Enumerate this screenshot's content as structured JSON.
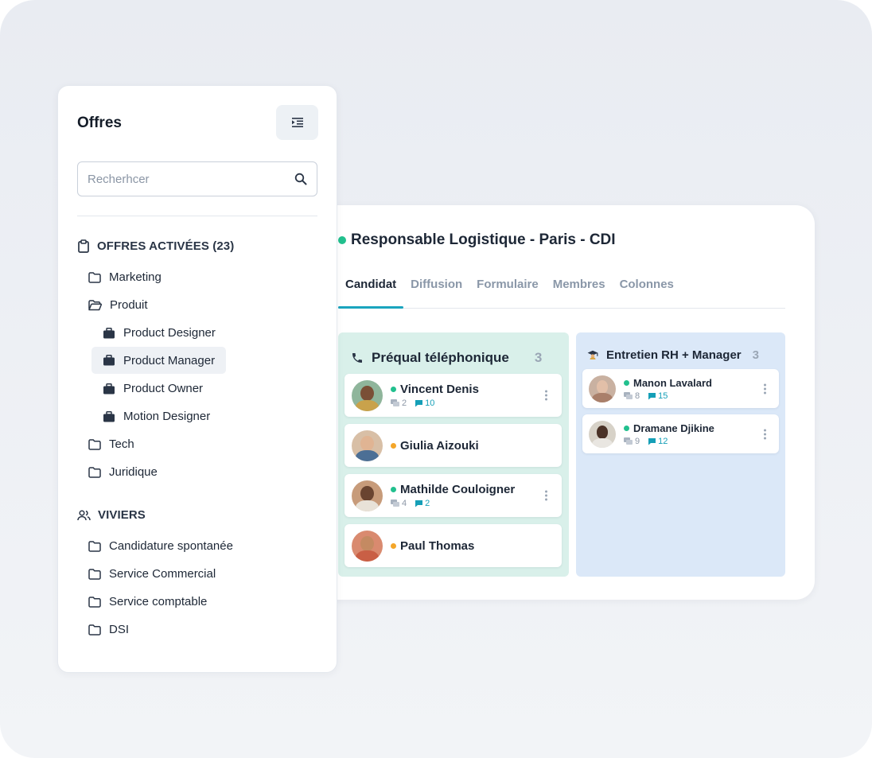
{
  "sidebar": {
    "title": "Offres",
    "search_placeholder": "Recherhcer",
    "active_section": "OFFRES ACTIVÉES (23)",
    "active_folders": {
      "marketing": "Marketing",
      "produit": "Produit",
      "produit_items": [
        "Product Designer",
        "Product Manager",
        "Product Owner",
        "Motion Designer"
      ],
      "tech": "Tech",
      "juridique": "Juridique"
    },
    "pools_section": "VIVIERS",
    "pool_folders": [
      "Candidature spontanée",
      "Service Commercial",
      "Service comptable",
      "DSI"
    ],
    "selected_item": "Product Manager"
  },
  "job": {
    "title": "Responsable Logistique - Paris - CDI",
    "status_color": "#22c08e",
    "tabs": [
      "Candidat",
      "Diffusion",
      "Formulaire",
      "Membres",
      "Colonnes"
    ],
    "active_tab": "Candidat"
  },
  "columns": [
    {
      "title": "Préqual téléphonique",
      "icon": "phone-icon",
      "count": "3",
      "cards": [
        {
          "name": "Vincent Denis",
          "status_color": "#22c08e",
          "messages": "2",
          "comments": "10"
        },
        {
          "name": "Giulia Aizouki",
          "status_color": "#f4a629"
        },
        {
          "name": "Mathilde Couloigner",
          "status_color": "#22c08e",
          "messages": "4",
          "comments": "2"
        },
        {
          "name": "Paul Thomas",
          "status_color": "#f4a629"
        }
      ]
    },
    {
      "title": "Entretien RH + Manager",
      "icon": "graduate-icon",
      "count": "3",
      "cards": [
        {
          "name": "Manon Lavalard",
          "status_color": "#22c08e",
          "messages": "8",
          "comments": "15"
        },
        {
          "name": "Dramane Djikine",
          "status_color": "#22c08e",
          "messages": "9",
          "comments": "12"
        }
      ]
    }
  ],
  "colors": {
    "accent": "#1aa4be",
    "column_a_bg": "#d9f0ea",
    "column_b_bg": "#dbe8f8"
  }
}
